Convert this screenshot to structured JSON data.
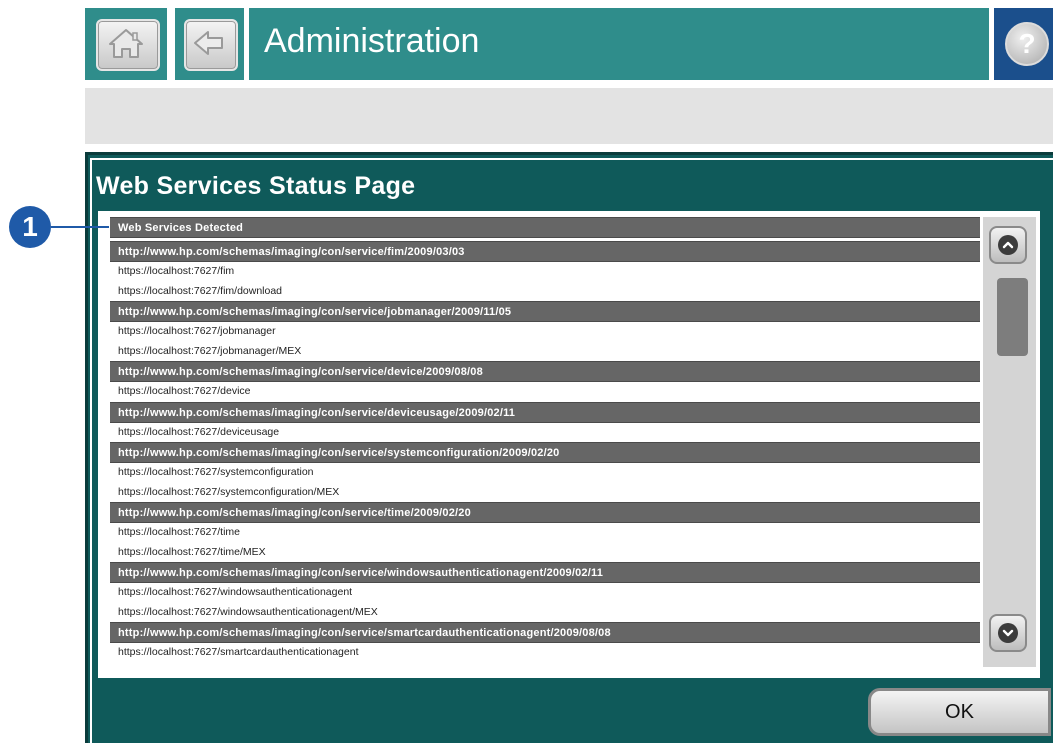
{
  "header": {
    "title": "Administration",
    "home_icon": "house-icon",
    "back_icon": "left-arrow-icon",
    "help_label": "?"
  },
  "dialog": {
    "title": "Web Services Status Page",
    "list": {
      "top_header": "Web Services Detected",
      "groups": [
        {
          "header": "http://www.hp.com/schemas/imaging/con/service/fim/2009/03/03",
          "urls": [
            "https://localhost:7627/fim",
            "https://localhost:7627/fim/download"
          ]
        },
        {
          "header": "http://www.hp.com/schemas/imaging/con/service/jobmanager/2009/11/05",
          "urls": [
            "https://localhost:7627/jobmanager",
            "https://localhost:7627/jobmanager/MEX"
          ]
        },
        {
          "header": "http://www.hp.com/schemas/imaging/con/service/device/2009/08/08",
          "urls": [
            "https://localhost:7627/device"
          ]
        },
        {
          "header": "http://www.hp.com/schemas/imaging/con/service/deviceusage/2009/02/11",
          "urls": [
            "https://localhost:7627/deviceusage"
          ]
        },
        {
          "header": "http://www.hp.com/schemas/imaging/con/service/systemconfiguration/2009/02/20",
          "urls": [
            "https://localhost:7627/systemconfiguration",
            "https://localhost:7627/systemconfiguration/MEX"
          ]
        },
        {
          "header": "http://www.hp.com/schemas/imaging/con/service/time/2009/02/20",
          "urls": [
            "https://localhost:7627/time",
            "https://localhost:7627/time/MEX"
          ]
        },
        {
          "header": "http://www.hp.com/schemas/imaging/con/service/windowsauthenticationagent/2009/02/11",
          "urls": [
            "https://localhost:7627/windowsauthenticationagent",
            "https://localhost:7627/windowsauthenticationagent/MEX"
          ]
        },
        {
          "header": "http://www.hp.com/schemas/imaging/con/service/smartcardauthenticationagent/2009/08/08",
          "urls": [
            "https://localhost:7627/smartcardauthenticationagent"
          ]
        }
      ]
    },
    "ok_label": "OK"
  },
  "callout": {
    "number": "1"
  },
  "colors": {
    "header_teal": "#2f8d8b",
    "dialog_teal": "#0f5a5a",
    "help_blue": "#1b4f8c",
    "row_header_gray": "#666666",
    "callout_blue": "#1f5aa8"
  }
}
